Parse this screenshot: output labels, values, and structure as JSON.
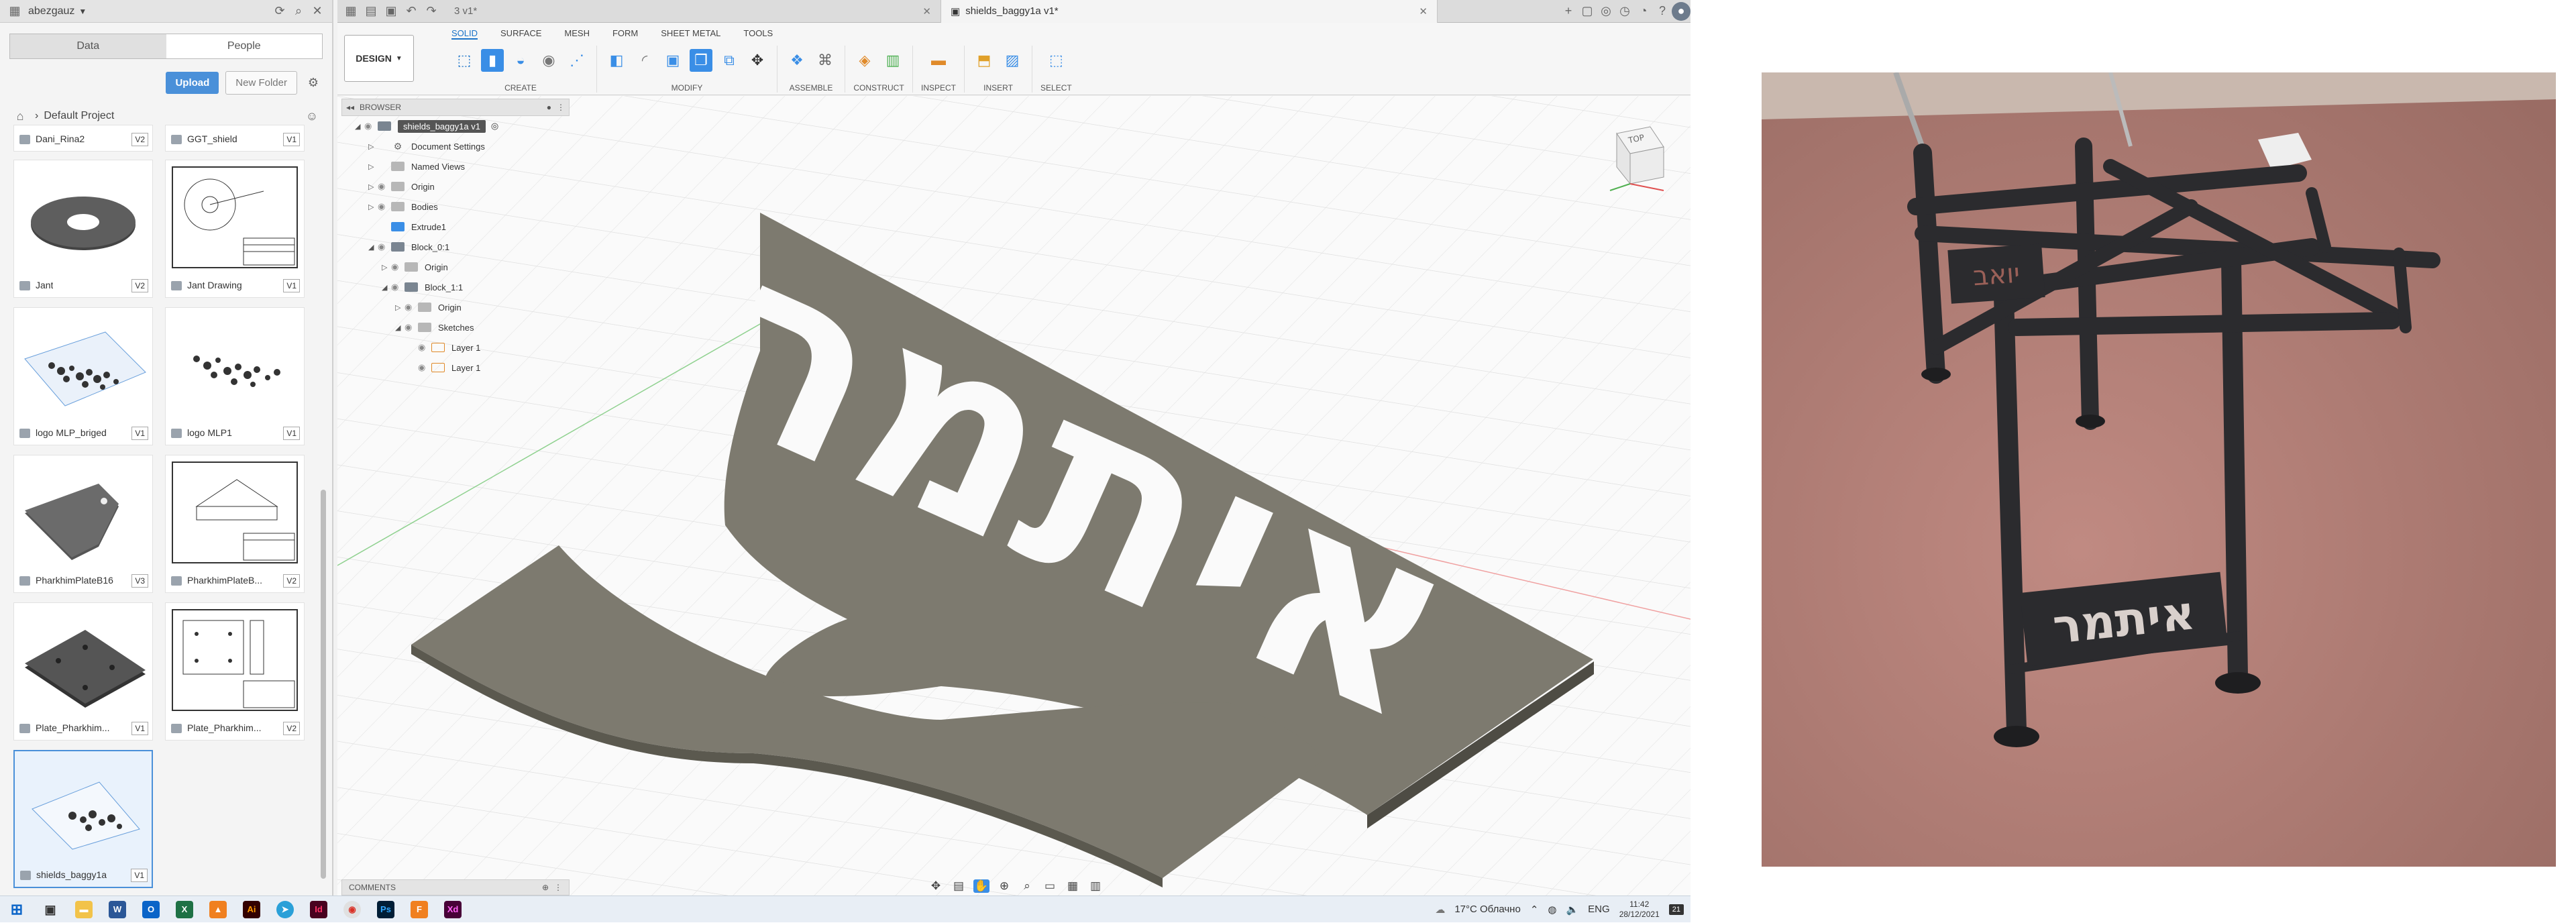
{
  "data_panel": {
    "user": "abezgauz",
    "tabs": [
      "Data",
      "People"
    ],
    "upload_label": "Upload",
    "new_folder_label": "New Folder",
    "project_name": "Default Project",
    "items": [
      {
        "name": "Dani_Rina2",
        "version": "V2"
      },
      {
        "name": "GGT_shield",
        "version": "V1"
      },
      {
        "name": "Jant",
        "version": "V2"
      },
      {
        "name": "Jant Drawing",
        "version": "V1"
      },
      {
        "name": "logo MLP_briged",
        "version": "V1"
      },
      {
        "name": "logo MLP1",
        "version": "V1"
      },
      {
        "name": "PharkhimPlateB16",
        "version": "V3"
      },
      {
        "name": "PharkhimPlateB...",
        "version": "V2"
      },
      {
        "name": "Plate_Pharkhim...",
        "version": "V1"
      },
      {
        "name": "Plate_Pharkhim...",
        "version": "V2"
      },
      {
        "name": "shields_baggy1a",
        "version": "V1"
      }
    ]
  },
  "tabs": [
    {
      "label": "3 v1*"
    },
    {
      "label": "shields_baggy1a v1*"
    }
  ],
  "ribbon": {
    "design_label": "DESIGN",
    "tabs": [
      "SOLID",
      "SURFACE",
      "MESH",
      "FORM",
      "SHEET METAL",
      "TOOLS"
    ],
    "groups": [
      "CREATE",
      "MODIFY",
      "ASSEMBLE",
      "CONSTRUCT",
      "INSPECT",
      "INSERT",
      "SELECT"
    ]
  },
  "browser": {
    "title": "BROWSER",
    "root": "shields_baggy1a v1",
    "items": [
      {
        "label": "Document Settings"
      },
      {
        "label": "Named Views"
      },
      {
        "label": "Origin"
      },
      {
        "label": "Bodies"
      },
      {
        "label": "Extrude1"
      },
      {
        "label": "Block_0:1"
      },
      {
        "label": "Origin"
      },
      {
        "label": "Block_1:1"
      },
      {
        "label": "Origin"
      },
      {
        "label": "Sketches"
      },
      {
        "label": "Layer 1"
      },
      {
        "label": "Layer 1"
      }
    ]
  },
  "model": {
    "text": "איתמר",
    "color": "#7d7a6f"
  },
  "viewcube_label": "TOP",
  "comments_label": "COMMENTS",
  "taskbar": {
    "weather": "17°C Облачно",
    "lang": "ENG",
    "time": "11:42",
    "date": "28/12/2021",
    "notifications": "21"
  },
  "photo": {
    "stand_text": "איתמר",
    "small_sign": "יואב"
  },
  "colors": {
    "accent": "#1a73c8",
    "upload": "#4a90d9",
    "floor": "#b07a72",
    "metal": "#2b2b2e"
  }
}
